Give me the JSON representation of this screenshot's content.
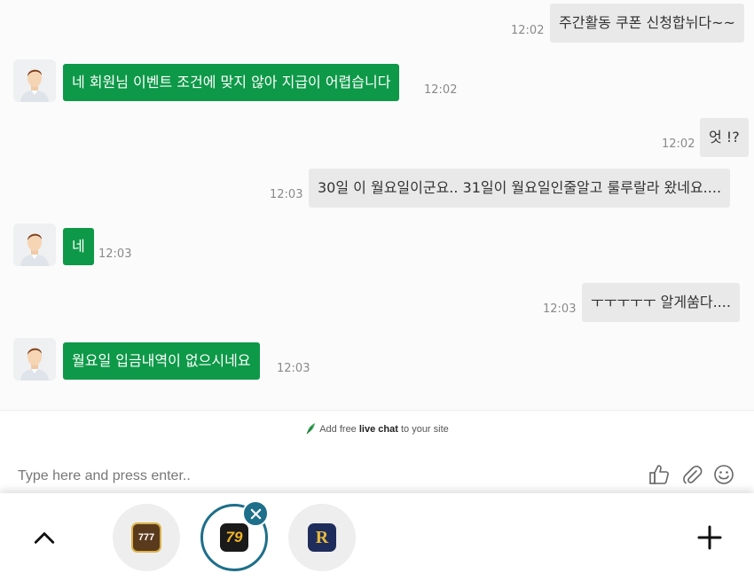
{
  "messages": [
    {
      "side": "out",
      "text": "주간활동 쿠폰 신청합뉘다~~",
      "time": "12:02"
    },
    {
      "side": "in",
      "text": "네 회원님 이벤트 조건에 맞지 않아 지급이 어렵습니다",
      "time": "12:02"
    },
    {
      "side": "out",
      "text": "엇 !?",
      "time": "12:02"
    },
    {
      "side": "out",
      "text": "30일 이 월요일이군요.. 31일이 월요일인줄알고 룰루랄라 왔네요....",
      "time": "12:03"
    },
    {
      "side": "in",
      "text": "네",
      "time": "12:03"
    },
    {
      "side": "out",
      "text": "ㅜㅜㅜㅜㅜ 알게쑴다....",
      "time": "12:03"
    },
    {
      "side": "in",
      "text": "월요일 입금내역이 없으시네요",
      "time": "12:03"
    }
  ],
  "branding": {
    "prefix": "Add free",
    "bold": "live chat",
    "suffix": "to your site"
  },
  "composer": {
    "placeholder": "Type here and press enter.."
  },
  "icons": {
    "like": "thumbs-up-icon",
    "attach": "paperclip-icon",
    "emoji": "smiley-icon",
    "up": "chevron-up-icon",
    "add": "plus-icon",
    "close": "close-icon"
  },
  "tray": {
    "apps": [
      {
        "label": "777",
        "accent": "#c9a227"
      },
      {
        "label": "79",
        "accent": "#e0a020"
      },
      {
        "label": "R",
        "accent": "#d4a52a"
      }
    ]
  },
  "colors": {
    "agent_bubble": "#0d9948",
    "visitor_bubble": "#e9e9e9",
    "accent": "#1e6f8a"
  }
}
